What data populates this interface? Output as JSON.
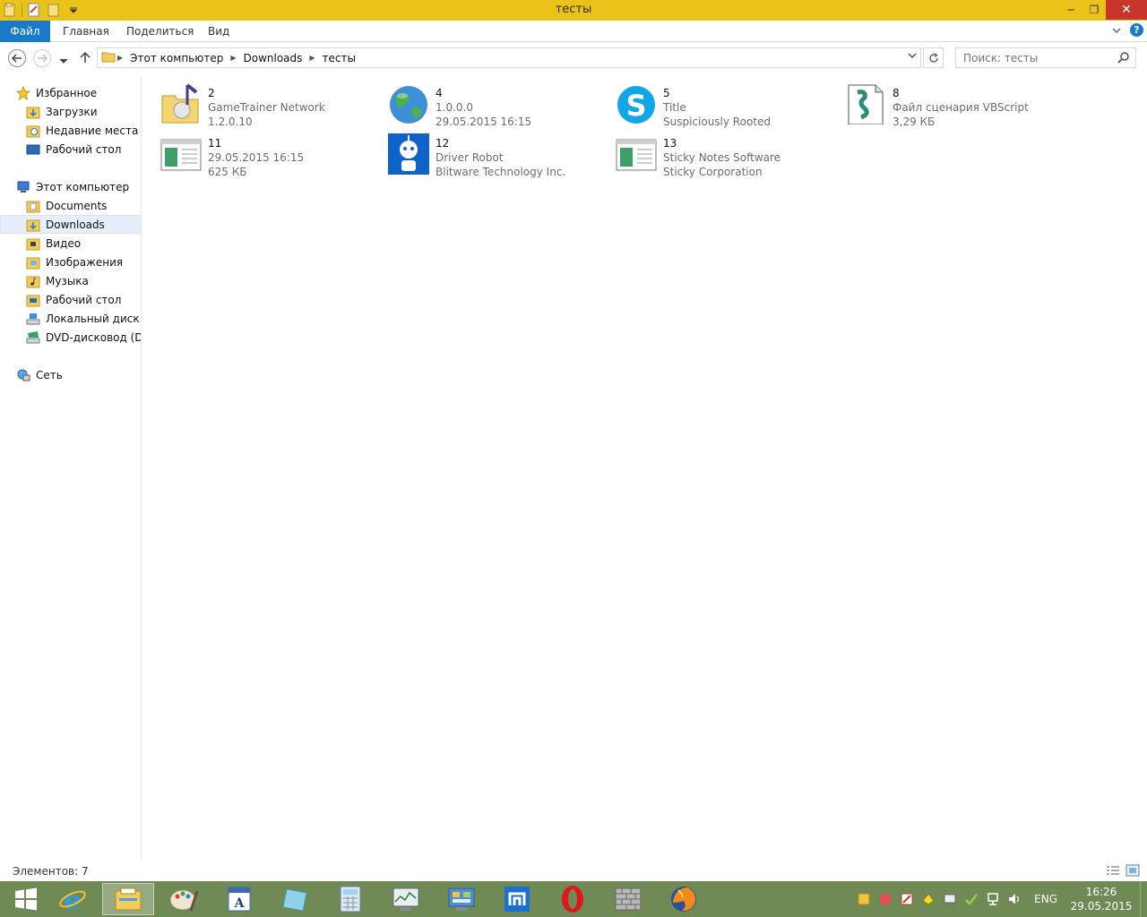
{
  "window": {
    "title": "тесты",
    "controls": {
      "minimize": "─",
      "maximize": "❐",
      "close": "✕"
    }
  },
  "ribbon": {
    "tabs": [
      "Файл",
      "Главная",
      "Поделиться",
      "Вид"
    ]
  },
  "address": {
    "crumbs": [
      "Этот компьютер",
      "Downloads",
      "тесты"
    ],
    "search_placeholder": "Поиск: тесты"
  },
  "sidebar": {
    "favorites_label": "Избранное",
    "favorites": [
      "Загрузки",
      "Недавние места",
      "Рабочий стол"
    ],
    "computer_label": "Этот компьютер",
    "computer": [
      "Documents",
      "Downloads",
      "Видео",
      "Изображения",
      "Музыка",
      "Рабочий стол",
      "Локальный диск (C:)",
      "DVD-дисковод (D:) V"
    ],
    "selected": "Downloads",
    "network_label": "Сеть"
  },
  "files": [
    {
      "name": "2",
      "line1": "GameTrainer Network",
      "line2": "1.2.0.10",
      "icon": "folder-music-icon"
    },
    {
      "name": "4",
      "line1": "1.0.0.0",
      "line2": "29.05.2015 16:15",
      "icon": "globe-icon"
    },
    {
      "name": "5",
      "line1": "Title",
      "line2": "Suspiciously Rooted",
      "icon": "skype-icon"
    },
    {
      "name": "8",
      "line1": "Файл сценария VBScript",
      "line2": "3,29 КБ",
      "icon": "vbscript-file-icon"
    },
    {
      "name": "11",
      "line1": "29.05.2015 16:15",
      "line2": "625 КБ",
      "icon": "application-window-icon"
    },
    {
      "name": "12",
      "line1": "Driver Robot",
      "line2": "Blitware Technology Inc.",
      "icon": "driver-robot-icon"
    },
    {
      "name": "13",
      "line1": "Sticky Notes Software",
      "line2": "Sticky Corporation",
      "icon": "application-window-icon"
    }
  ],
  "status": {
    "item_count": "Элементов: 7"
  },
  "taskbar": {
    "apps": [
      "start-icon",
      "internet-explorer-icon",
      "file-explorer-icon",
      "paint-icon",
      "wordpad-icon",
      "sticky-notes-icon",
      "calculator-icon",
      "resource-monitor-icon",
      "control-panel-icon",
      "maxthon-icon",
      "opera-icon",
      "firewall-icon",
      "firefox-icon"
    ],
    "language": "ENG",
    "time": "16:26",
    "date": "29.05.2015"
  },
  "colors": {
    "titlebar": "#e9c31a",
    "accent": "#1979ca",
    "taskbar": "#6f8a54",
    "close": "#c7352b"
  }
}
